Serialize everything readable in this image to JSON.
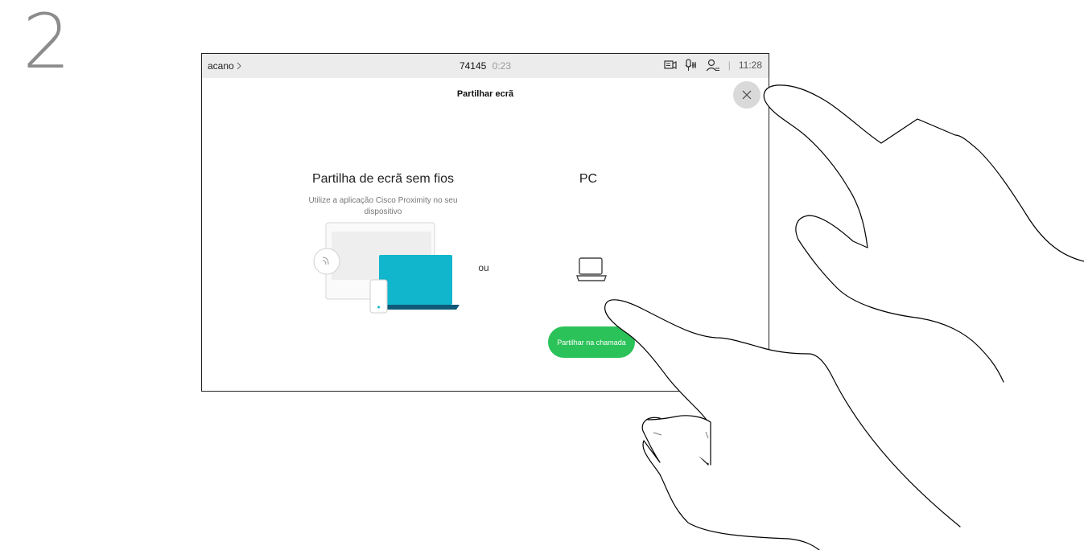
{
  "step": {
    "number": "2"
  },
  "status_bar": {
    "location": "acano",
    "call_number": "74145",
    "call_duration": "0:23",
    "separator": "|",
    "clock": "11:28",
    "icons": [
      "share-screen-icon",
      "microphone-icon",
      "participants-icon"
    ]
  },
  "dialog": {
    "title": "Partilhar ecrã",
    "close_icon": "close-icon",
    "wireless": {
      "title": "Partilha de ecrã sem fios",
      "subtitle": "Utilize a aplicação Cisco Proximity no seu dispositivo"
    },
    "or_label": "ou",
    "pc": {
      "title": "PC",
      "icon": "laptop-icon"
    },
    "share_button": "Partilhar na chamada"
  },
  "colors": {
    "share_button": "#2bc25a",
    "laptop_screen": "#12b6cc",
    "laptop_base": "#0e5a78",
    "status_bar": "#ececec"
  }
}
